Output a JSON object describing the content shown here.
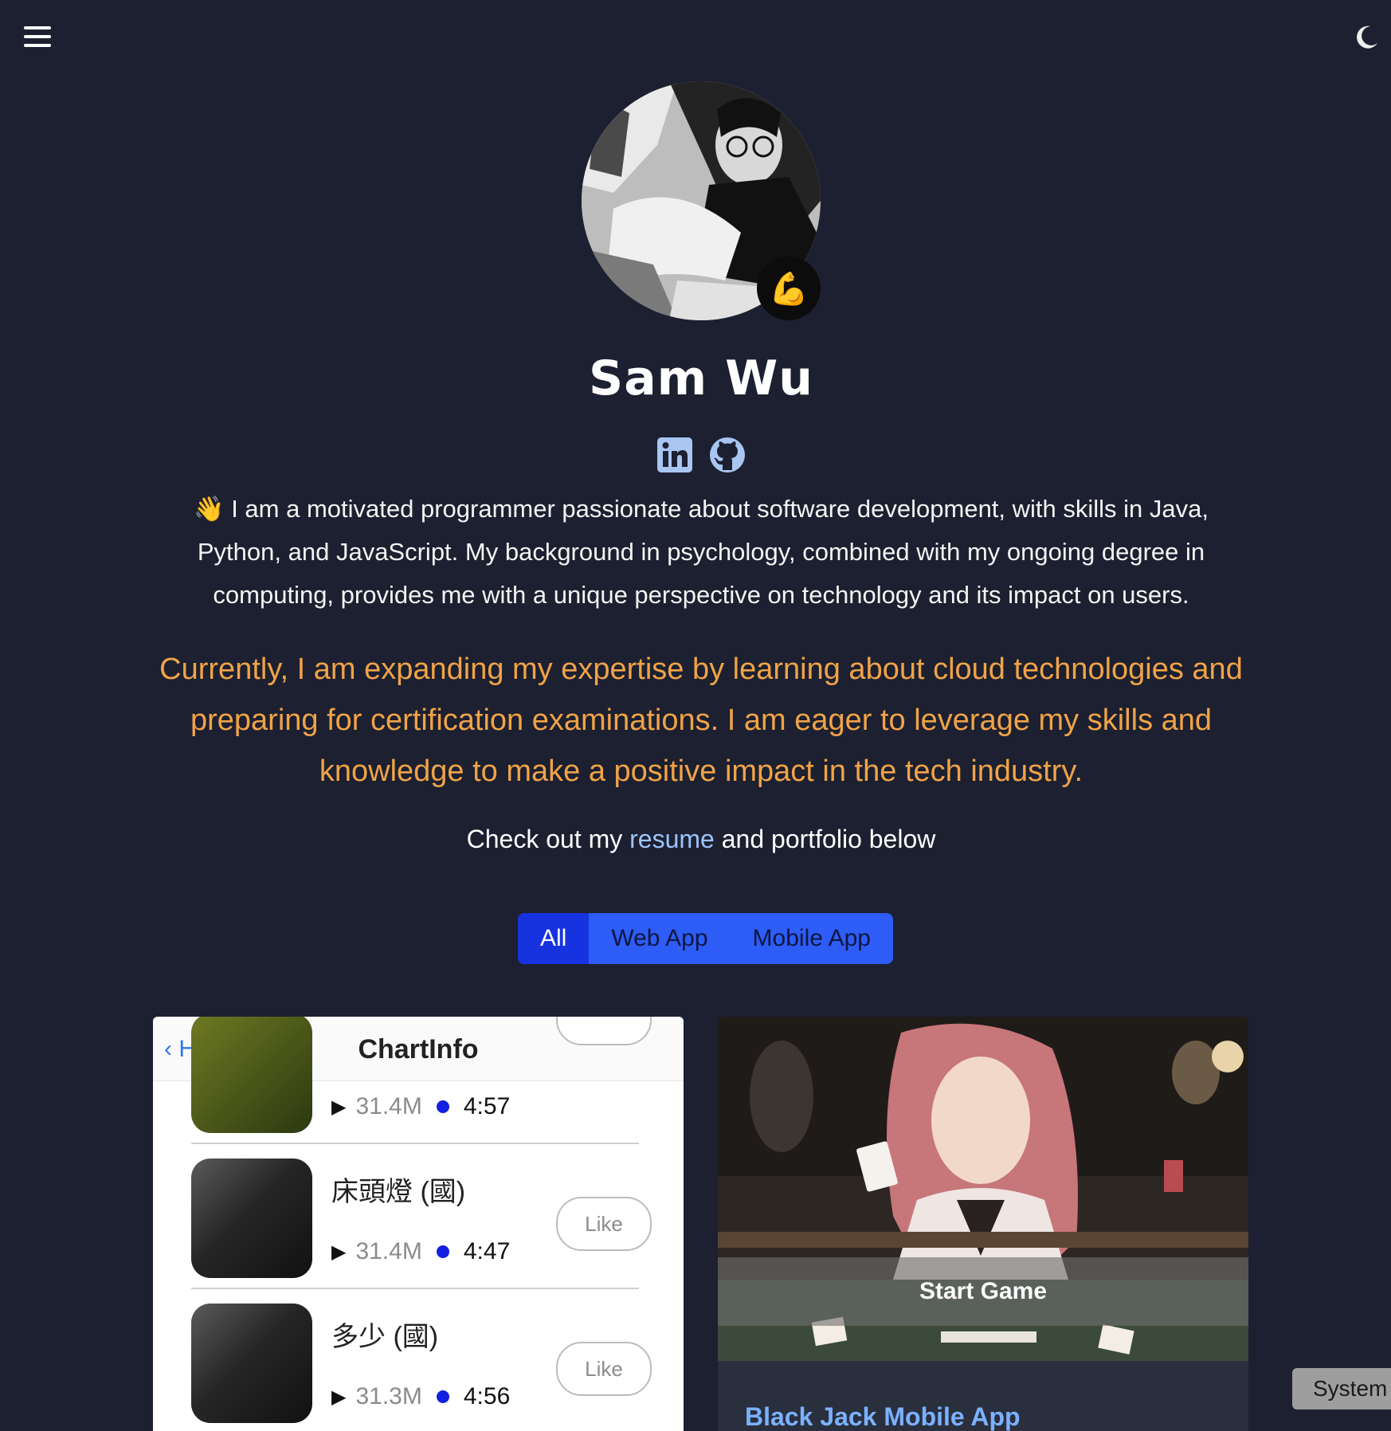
{
  "header": {
    "menu_icon": "hamburger-icon",
    "theme_icon": "moon-icon"
  },
  "profile": {
    "name": "Sam Wu",
    "badge_emoji": "💪",
    "social": [
      "linkedin-icon",
      "github-icon"
    ]
  },
  "bio": {
    "intro": "👋 I am a motivated programmer passionate about software development, with skills in Java, Python, and JavaScript. My background in psychology, combined with my ongoing degree in computing, provides me with a unique perspective on technology and its impact on users.",
    "highlight": "Currently, I am expanding my expertise by learning about cloud technologies and preparing for certification examinations. I am eager to leverage my skills and knowledge to make a positive impact in the tech industry.",
    "cta_prefix": "Check out my ",
    "cta_link": "resume",
    "cta_suffix": " and portfolio below"
  },
  "filters": [
    "All",
    "Web App",
    "Mobile App"
  ],
  "cards": {
    "left": {
      "back_label": "Home",
      "title": "ChartInfo",
      "songs": [
        {
          "title": "",
          "plays": "31.4M",
          "duration": "4:57",
          "like": ""
        },
        {
          "title": "床頭燈 (國)",
          "plays": "31.4M",
          "duration": "4:47",
          "like": "Like"
        },
        {
          "title": "多少 (國)",
          "plays": "31.3M",
          "duration": "4:56",
          "like": "Like"
        }
      ]
    },
    "right": {
      "start_label": "Start Game",
      "title": "Black Jack Mobile App"
    }
  },
  "language_badge": "System",
  "colors": {
    "background": "#1c2030",
    "highlight_text": "#f0a347",
    "filter_active": "#1733e0",
    "filter_bg": "#2d5cf6",
    "link": "#9ec3ff"
  }
}
